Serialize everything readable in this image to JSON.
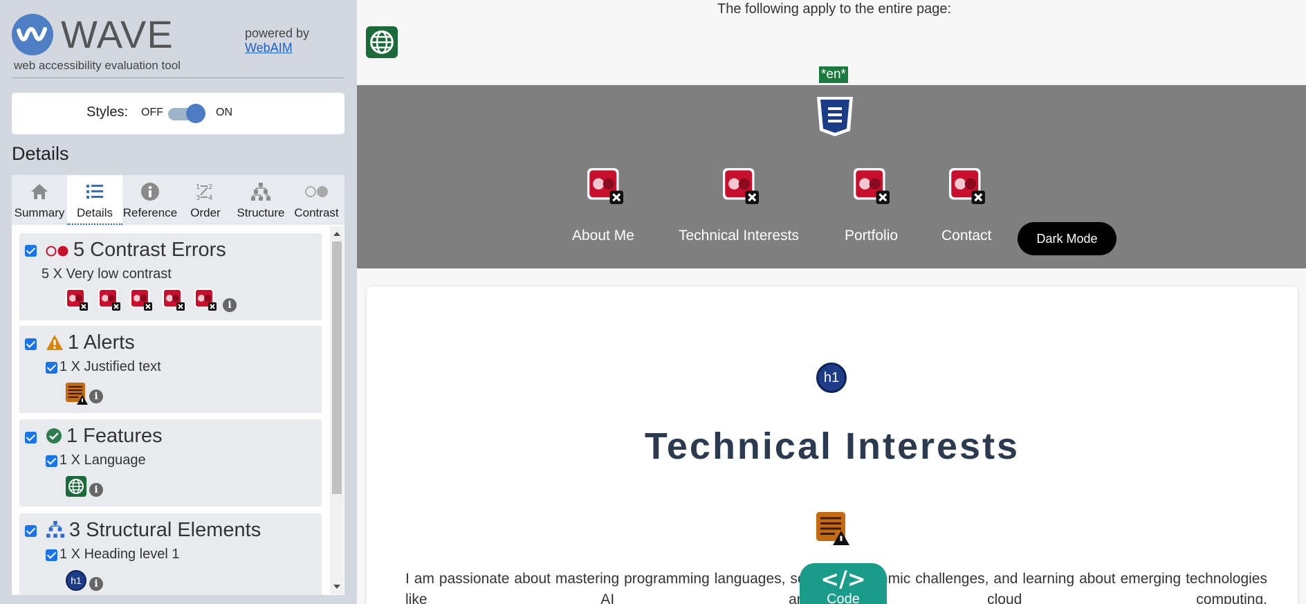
{
  "wave": {
    "logo_text": "WAVE",
    "subtitle": "web accessibility evaluation tool",
    "powered_by": "powered by",
    "webaim_link": "WebAIM",
    "styles_label": "Styles:",
    "toggle_off": "OFF",
    "toggle_on": "ON",
    "details_title": "Details",
    "tabs": [
      {
        "label": "Summary",
        "icon": "home-icon"
      },
      {
        "label": "Details",
        "icon": "list-icon",
        "active": true
      },
      {
        "label": "Reference",
        "icon": "info-icon"
      },
      {
        "label": "Order",
        "icon": "order-icon"
      },
      {
        "label": "Structure",
        "icon": "structure-icon"
      },
      {
        "label": "Contrast",
        "icon": "contrast-icon"
      }
    ],
    "categories": {
      "contrast": {
        "title": "5 Contrast Errors",
        "item": "5 X Very low contrast",
        "count": 5
      },
      "alerts": {
        "title": "1 Alerts",
        "item": "1 X Justified text"
      },
      "features": {
        "title": "1 Features",
        "item": "1 X Language"
      },
      "structure": {
        "title": "3 Structural Elements",
        "item": "1 X Heading level 1",
        "badge": "h1"
      }
    }
  },
  "page": {
    "note": "The following apply to the entire page:",
    "lang_badge": "*en*",
    "nav": [
      "About Me",
      "Technical Interests",
      "Portfolio",
      "Contact"
    ],
    "dark_mode": "Dark Mode",
    "h1_badge": "h1",
    "heading": "Technical Interests",
    "paragraph": "I am passionate about mastering programming languages, solving algorithmic challenges, and learning about emerging technologies like AI and cloud computing.",
    "code_symbol": "</>",
    "code_label": "Code"
  },
  "colors": {
    "sidebar_bg": "#d3d8e0",
    "accent_blue": "#1c5fce",
    "error_red": "#c8102e",
    "alert_orange": "#c46a12",
    "feature_green": "#1a7a3e",
    "nav_band": "#7f7f7f",
    "heading_color": "#2b3a4e",
    "code_teal": "#1a9c8a"
  }
}
